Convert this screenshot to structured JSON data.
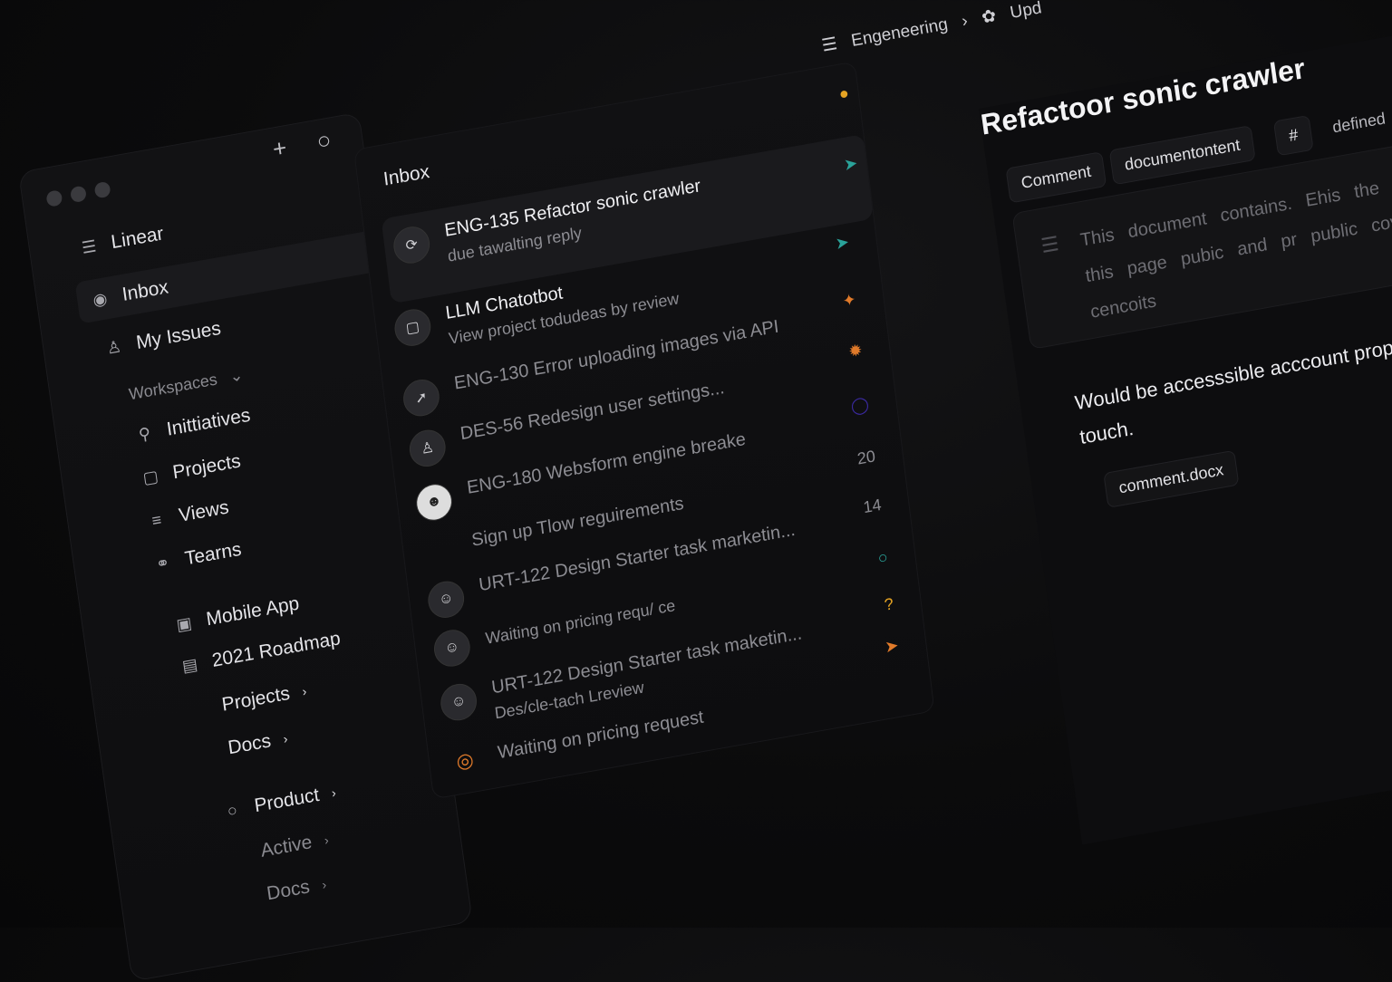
{
  "breadcrumb": {
    "section": "Engeneering",
    "next": "Upd"
  },
  "sidebar": {
    "app_name": "Linear",
    "items": [
      {
        "label": "Inbox"
      },
      {
        "label": "My Issues"
      }
    ],
    "workspaces_label": "Workspaces",
    "workspace_items": [
      {
        "label": "Inittiatives"
      },
      {
        "label": "Projects"
      },
      {
        "label": "Views"
      },
      {
        "label": "Tearns"
      }
    ],
    "project_items": [
      {
        "label": "Mobile App"
      },
      {
        "label": "2021 Roadmap"
      },
      {
        "label": "Projects"
      },
      {
        "label": "Docs"
      }
    ],
    "product_items": [
      {
        "label": "Product"
      },
      {
        "label": "Active"
      },
      {
        "label": "Docs"
      }
    ]
  },
  "inbox": {
    "title": "Inbox",
    "rows": [
      {
        "title": "ENG-135 Refactor sonic crawler",
        "subtitle": "due tawalting reply"
      },
      {
        "title": "LLM Chatotbot",
        "subtitle": "View project todudeas by review"
      },
      {
        "title": "ENG-130 Error uploading images via API"
      },
      {
        "title": "DES-56 Redesign user settings..."
      },
      {
        "title": "ENG-180 Websform engine breake"
      },
      {
        "title": "Sign up Tlow reguirements"
      },
      {
        "title": "URT-122 Design Starter task marketin..."
      },
      {
        "title": "Waiting on pricing requ/ ce"
      },
      {
        "title": "URT-122 Design Starter  task maketin..."
      },
      {
        "title": "Des/cle-tach Lreview"
      },
      {
        "title": "Waiting on pricing request"
      }
    ],
    "counts": [
      "20",
      "14"
    ]
  },
  "detail": {
    "title": "Refactoor sonic crawler",
    "chips": [
      "Comment",
      "documentontent"
    ],
    "tag_extra": "defined",
    "doc_text": "This document contains. Ehis the editing this page pubic and pr public covane cencoits",
    "body": "Would be accesssible acccount property touch.",
    "attachment": "comment.docx"
  },
  "colors": {
    "accent_yellow": "#e5a323",
    "accent_teal": "#2aa39a",
    "accent_orange": "#e07a2a"
  }
}
